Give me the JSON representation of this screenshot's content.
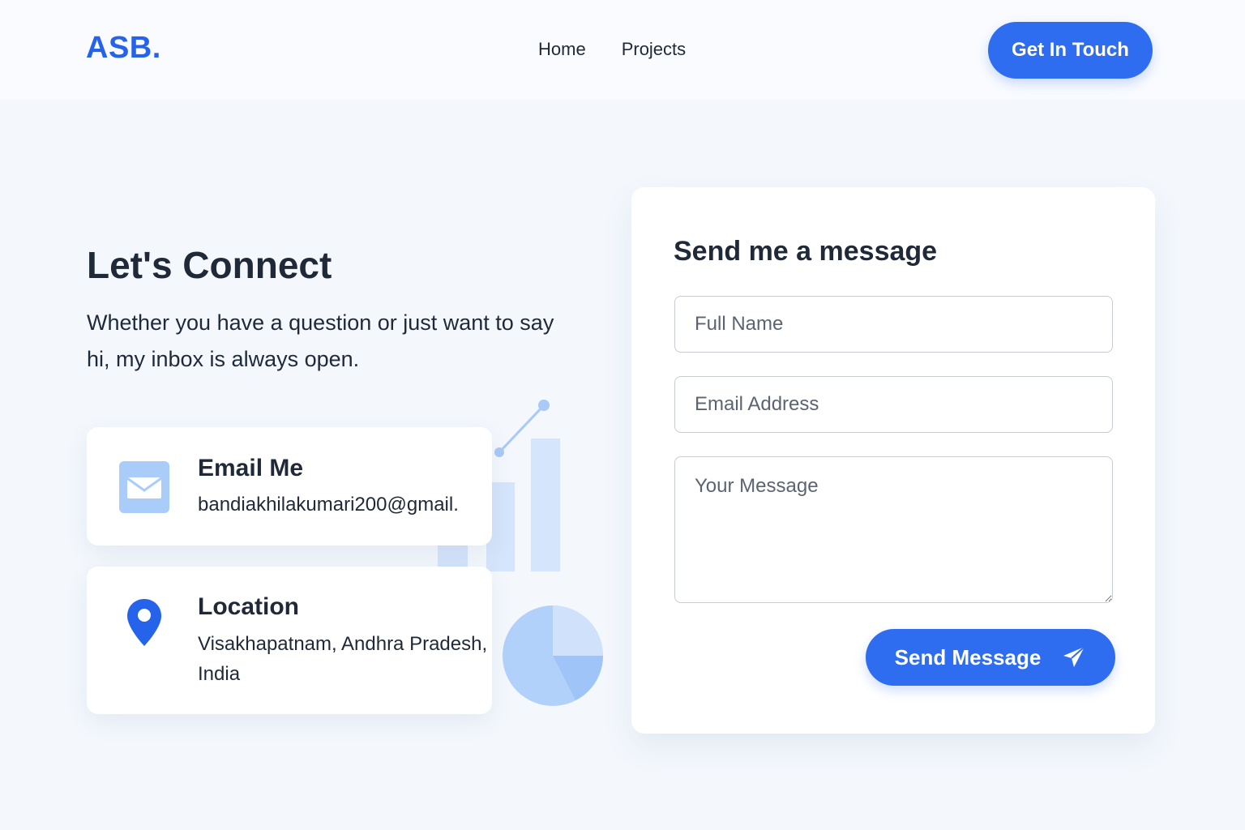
{
  "header": {
    "logo": "ASB.",
    "nav": [
      "Home",
      "Projects"
    ],
    "cta_label": "Get In Touch"
  },
  "hero": {
    "title": "Let's Connect",
    "subtitle": "Whether you have a question or just want to say hi, my inbox is always open."
  },
  "contact_cards": {
    "email": {
      "icon": "mail-icon",
      "title": "Email Me",
      "value": "bandiakhilakumari200@gmail."
    },
    "location": {
      "icon": "location-pin-icon",
      "title": "Location",
      "value": "Visakhapatnam, Andhra Pradesh, India"
    }
  },
  "form": {
    "title": "Send me a message",
    "name_placeholder": "Full Name",
    "email_placeholder": "Email Address",
    "message_placeholder": "Your Message",
    "submit_label": "Send Message",
    "submit_icon": "paper-plane-icon"
  },
  "colors": {
    "accent": "#2f6df0",
    "background": "#f4f8fd",
    "text": "#1f2937"
  }
}
